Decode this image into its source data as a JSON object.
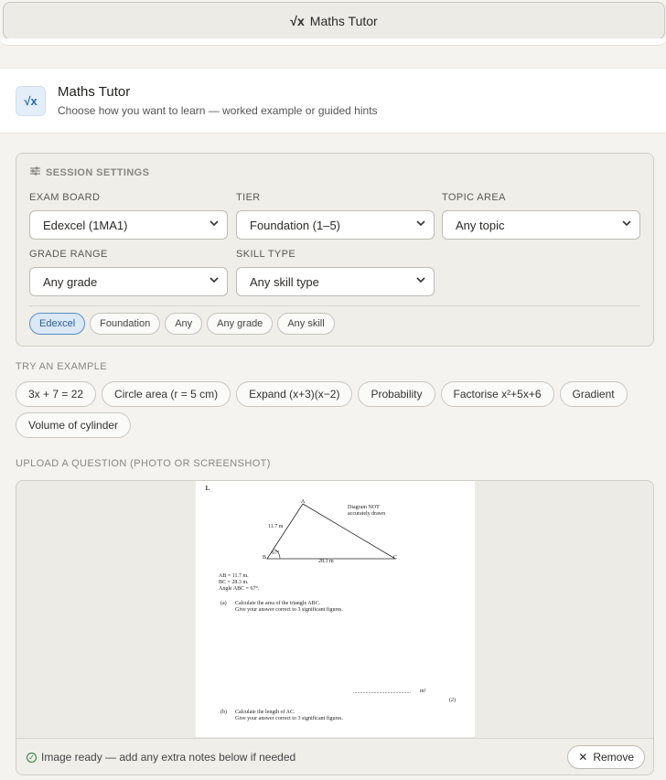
{
  "topbar": {
    "icon": "sqrt-x-icon",
    "glyph": "√x",
    "title": "Maths Tutor"
  },
  "header": {
    "logo_glyph": "√x",
    "title": "Maths Tutor",
    "subtitle": "Choose how you want to learn — worked example or guided hints"
  },
  "settings": {
    "title": "SESSION SETTINGS",
    "fields": {
      "exam_board": {
        "label": "EXAM BOARD",
        "value": "Edexcel (1MA1)"
      },
      "tier": {
        "label": "TIER",
        "value": "Foundation (1–5)"
      },
      "topic_area": {
        "label": "TOPIC AREA",
        "value": "Any topic"
      },
      "grade_range": {
        "label": "GRADE RANGE",
        "value": "Any grade"
      },
      "skill_type": {
        "label": "SKILL TYPE",
        "value": "Any skill type"
      }
    },
    "chips": [
      {
        "label": "Edexcel",
        "active": true
      },
      {
        "label": "Foundation",
        "active": false
      },
      {
        "label": "Any",
        "active": false
      },
      {
        "label": "Any grade",
        "active": false
      },
      {
        "label": "Any skill",
        "active": false
      }
    ]
  },
  "examples": {
    "label": "TRY AN EXAMPLE",
    "items": [
      "3x + 7 = 22",
      "Circle area (r = 5 cm)",
      "Expand (x+3)(x−2)",
      "Probability",
      "Factorise x²+5x+6",
      "Gradient",
      "Volume of cylinder"
    ]
  },
  "upload": {
    "label": "UPLOAD A QUESTION (PHOTO OR SCREENSHOT)",
    "paper": {
      "qnum": "1.",
      "diagram_note_1": "Diagram NOT",
      "diagram_note_2": "accurately drawn",
      "label_A": "A",
      "label_B": "B",
      "label_C": "C",
      "side_AB": "11.7 m",
      "side_BC": "28.3 m",
      "angle": "67°",
      "given_1": "AB = 11.7 m.",
      "given_2": "BC = 28.3 m.",
      "given_3": "Angle ABC = 67°.",
      "part_a_label": "(a)",
      "part_a_1": "Calculate the area of the triangle ABC.",
      "part_a_2": "Give your answer correct to 3 significant figures.",
      "answer_line": "..........................................",
      "answer_unit": "m²",
      "marks": "(2)",
      "part_b_label": "(b)",
      "part_b_1": "Calculate the length of AC.",
      "part_b_2": "Give your answer correct to 3 significant figures."
    },
    "status": "Image ready — add any extra notes below if needed",
    "remove_label": "Remove"
  }
}
